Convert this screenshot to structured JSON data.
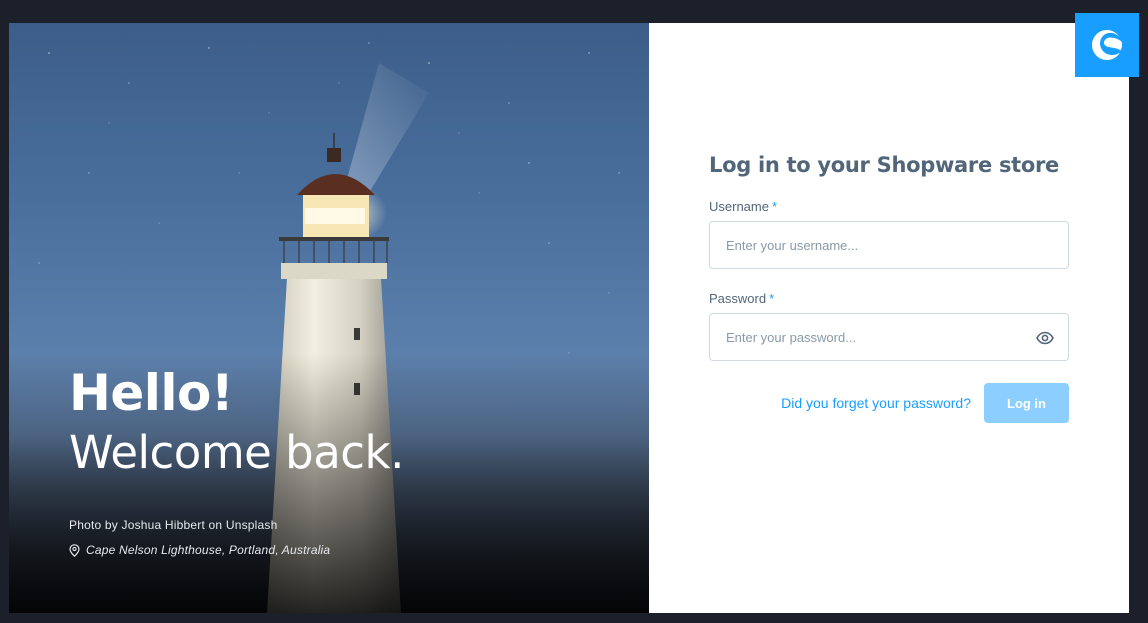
{
  "hero": {
    "hello": "Hello!",
    "welcome": "Welcome back.",
    "credit": "Photo by Joshua Hibbert on Unsplash",
    "location": "Cape Nelson Lighthouse, Portland, Australia",
    "location_icon": "map-pin-icon"
  },
  "brand": {
    "logo_icon": "shopware-logo-icon",
    "accent_color": "#189eff"
  },
  "login": {
    "title": "Log in to your Shopware store",
    "username_label": "Username",
    "username_placeholder": "Enter your username...",
    "username_value": "",
    "password_label": "Password",
    "password_placeholder": "Enter your password...",
    "password_value": "",
    "required_marker": "*",
    "password_toggle_icon": "eye-icon",
    "forgot_link": "Did you forget your password?",
    "submit_label": "Log in"
  }
}
